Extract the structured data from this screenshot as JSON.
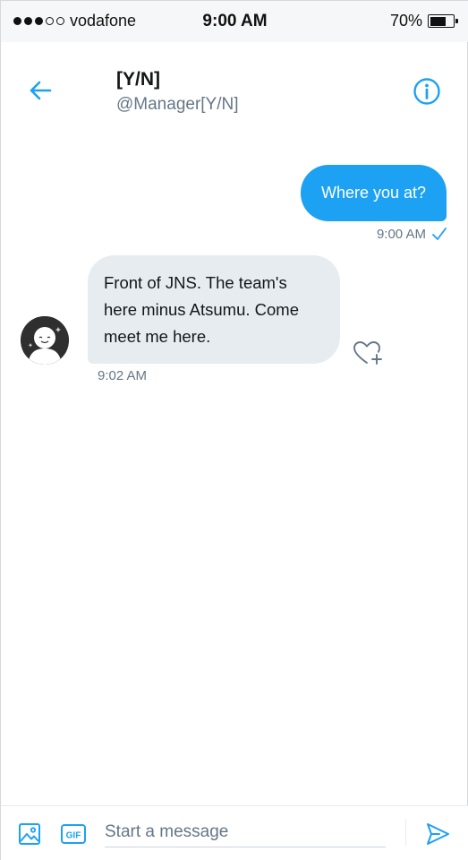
{
  "status_bar": {
    "carrier": "vodafone",
    "time": "9:00 AM",
    "battery": "70%",
    "battery_level": 0.7,
    "signal_bars_filled": 3,
    "signal_bars_total": 5
  },
  "header": {
    "name": "[Y/N]",
    "handle": "@Manager[Y/N]",
    "back_icon": "arrow-left-icon",
    "info_icon": "info-circle-icon"
  },
  "messages": [
    {
      "direction": "outgoing",
      "text": "Where you at?",
      "time": "9:00 AM",
      "status_icon": "check-icon"
    },
    {
      "direction": "incoming",
      "text": "Front of JNS. The team's here minus Atsumu. Come meet me here.",
      "time": "9:02 AM",
      "reaction_icon": "heart-plus-icon"
    }
  ],
  "composer": {
    "placeholder": "Start a message",
    "media_icon": "image-icon",
    "gif_label": "GIF",
    "send_icon": "send-icon"
  },
  "colors": {
    "accent": "#1da1f2",
    "incoming_bubble": "#e6ecf0",
    "secondary_text": "#657786"
  }
}
